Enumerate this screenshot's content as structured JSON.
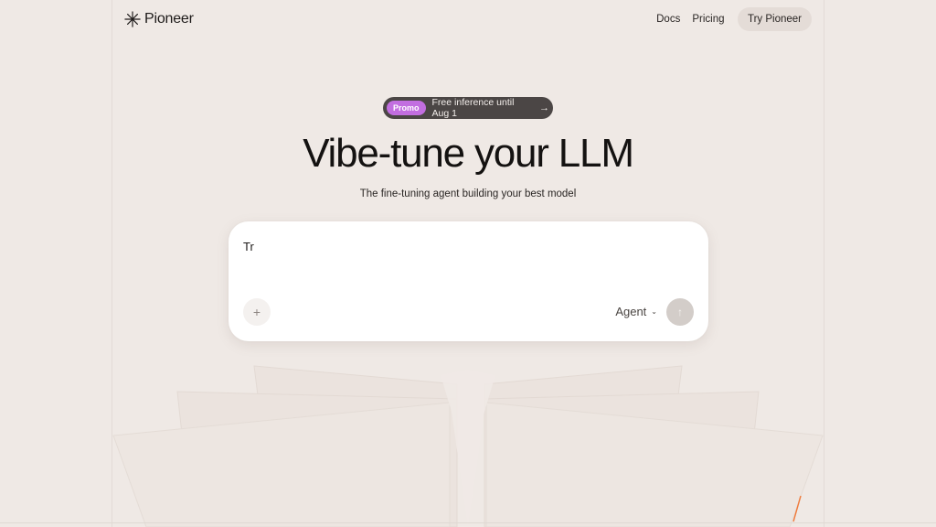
{
  "header": {
    "brand": "Pioneer",
    "nav": {
      "docs": "Docs",
      "pricing": "Pricing",
      "cta": "Try Pioneer"
    }
  },
  "promo": {
    "badge": "Promo",
    "text": "Free inference until Aug 1",
    "arrow": "→"
  },
  "hero": {
    "title": "Vibe-tune your LLM",
    "subtitle": "The fine-tuning agent building your best model"
  },
  "composer": {
    "input_value": "Tr",
    "add_glyph": "+",
    "mode": "Agent",
    "chevron": "⌄",
    "send_glyph": "↑"
  },
  "colors": {
    "background": "#efe9e5",
    "promo_badge": "#c26ee0",
    "send_disabled": "#d3cdc9",
    "accent_line": "#f07a3a"
  },
  "icons": [
    "sparkle-logo-icon",
    "arrow-right-icon",
    "plus-icon",
    "chevron-down-icon",
    "arrow-up-icon"
  ]
}
